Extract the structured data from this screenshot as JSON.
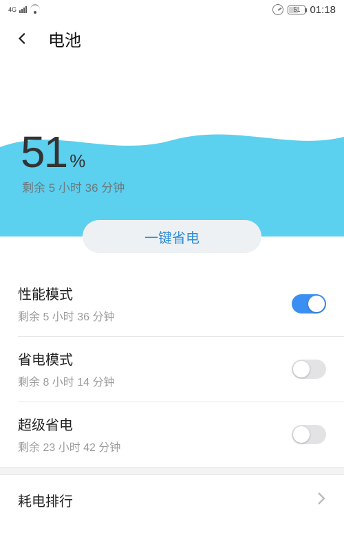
{
  "status": {
    "network_label": "4G",
    "battery_pct": "51",
    "time": "01:18"
  },
  "header": {
    "title": "电池"
  },
  "battery_panel": {
    "percent_number": "51",
    "percent_symbol": "%",
    "remaining": "剩余 5 小时 36 分钟",
    "onekey_label": "一键省电",
    "wave_color": "#5cd0ef",
    "accent_color": "#3b8ff3"
  },
  "modes": [
    {
      "title": "性能模式",
      "sub": "剩余 5 小时 36 分钟",
      "on": true
    },
    {
      "title": "省电模式",
      "sub": "剩余 8 小时 14 分钟",
      "on": false
    },
    {
      "title": "超级省电",
      "sub": "剩余 23 小时 42 分钟",
      "on": false
    }
  ],
  "rows": {
    "usage_ranking": "耗电排行"
  }
}
